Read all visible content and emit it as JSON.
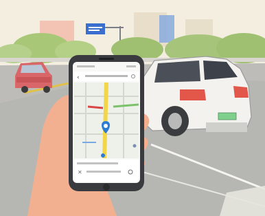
{
  "scene": {
    "description_colors": {
      "sky": "#f3eedf",
      "road": "#b9b8b4",
      "lane_yellow": "#e0c24a",
      "tree_green": "#9fc070",
      "car_white": "#f3f2ef",
      "car_red_left": "#d9676a",
      "taillight": "#e2574a",
      "skin": "#f2b090",
      "phone_body": "#3a3b3e",
      "map_route": "#f2d64a",
      "map_location": "#2e7bd6",
      "sign_blue": "#3a6fd0"
    }
  },
  "phone": {
    "status_bar": "",
    "search_bar": "",
    "bottom_sheet": "",
    "icons": [
      "back-arrow-icon",
      "location-pin-icon",
      "recenter-icon",
      "clock-icon"
    ]
  }
}
